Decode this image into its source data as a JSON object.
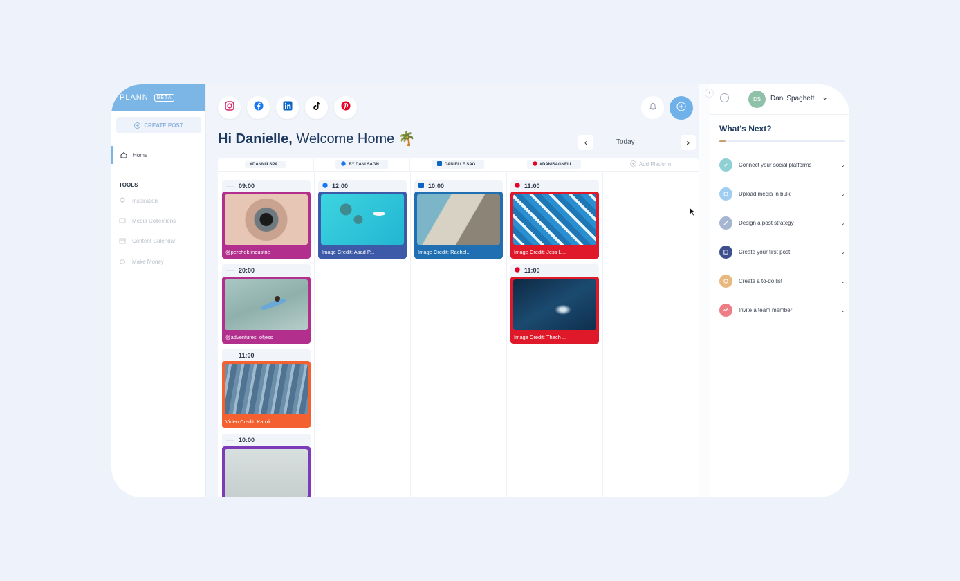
{
  "sidebar": {
    "brand": "PLANN",
    "badge": "BETA",
    "create_post": "CREATE POST",
    "home": "Home",
    "tools_title": "TOOLS",
    "tools": [
      "Inspiration",
      "Media Collections",
      "Content Calendar",
      "Make Money"
    ]
  },
  "header": {
    "social_icons": [
      "instagram-icon",
      "facebook-icon",
      "linkedin-icon",
      "tiktok-icon",
      "pinterest-icon"
    ],
    "greeting_bold": "Hi Danielle,",
    "greeting_rest": " Welcome Home",
    "greeting_emoji": "🌴",
    "today": "Today"
  },
  "columns": [
    {
      "label": "#DANNIILSPA...",
      "platform": "instagram"
    },
    {
      "label": "BY DANI SAGN...",
      "platform": "facebook"
    },
    {
      "label": "DANIELLE SAG...",
      "platform": "linkedin"
    },
    {
      "label": "#DANISAGNELL...",
      "platform": "pinterest"
    }
  ],
  "add_platform": "Add Platform",
  "posts": [
    {
      "time": "09:00",
      "caption": "@perchek.industrie"
    },
    {
      "time": "20:00",
      "caption": "@adventures_ofjess"
    },
    {
      "time": "11:00",
      "caption": "Video Credit: Karoli..."
    },
    {
      "time": "10:00",
      "caption": ""
    },
    {
      "time": "12:00",
      "caption": "Image Credit: Asad P..."
    },
    {
      "time": "10:00",
      "caption": "Image Credit: Rachel..."
    },
    {
      "time": "11:00",
      "caption": "Image Credit: Jess L..."
    },
    {
      "time": "11:00",
      "caption": "Image Credit: Thach ..."
    }
  ],
  "colors": {
    "instagram": "#b22f8e",
    "facebook": "#3d5aa8",
    "linkedin": "#1f6fb2",
    "pinterest": "#e0192a",
    "video": "#f4602f",
    "purple": "#7d3bb8",
    "accent": "#6fb1e8"
  },
  "right_panel": {
    "avatar_initials": "DS",
    "user_name": "Dani Spaghetti",
    "title": "What's Next?",
    "progress": 0.05,
    "steps": [
      "Connect your social platforms",
      "Upload media in bulk",
      "Design a post strategy",
      "Create your first post",
      "Create a to-do list",
      "Invite a team member"
    ]
  }
}
